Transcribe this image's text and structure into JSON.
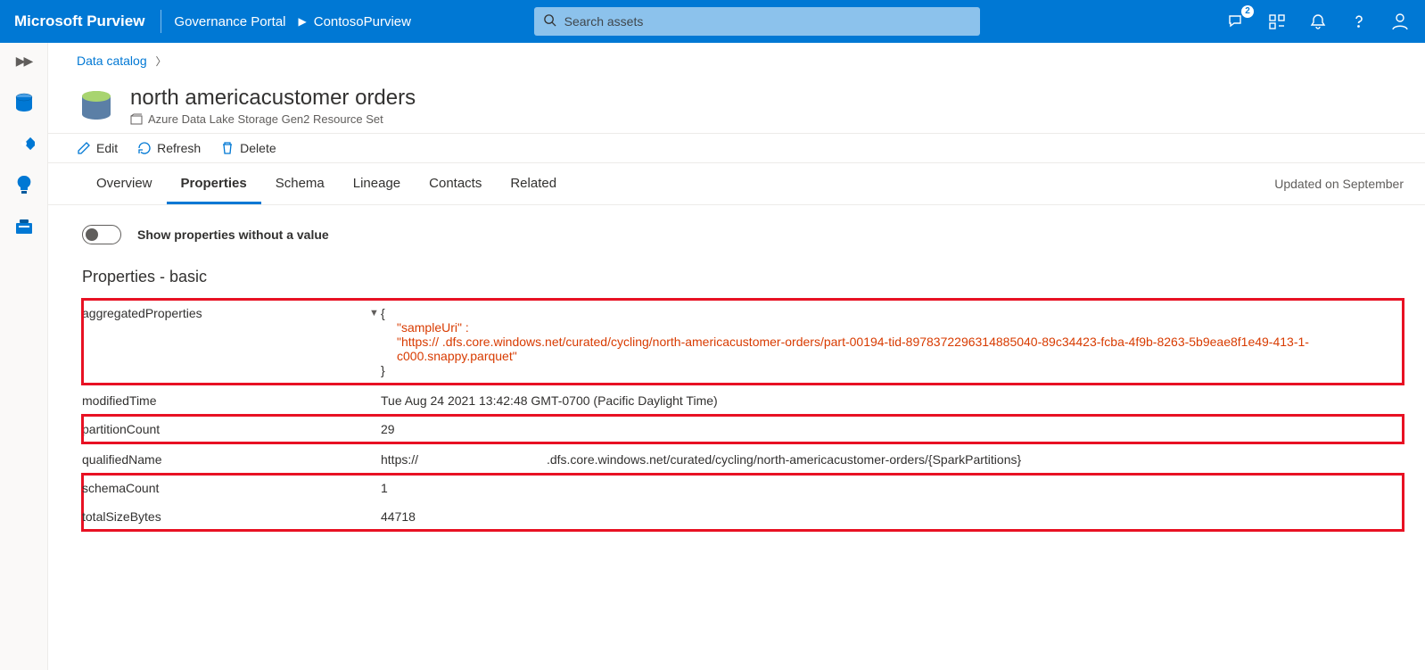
{
  "header": {
    "brand": "Microsoft Purview",
    "portal": "Governance Portal",
    "account": "ContosoPurview",
    "search_placeholder": "Search assets",
    "badge_feedback": "2"
  },
  "breadcrumb": {
    "link": "Data catalog"
  },
  "asset": {
    "title": "north americacustomer orders",
    "subtitle": "Azure Data Lake Storage Gen2 Resource Set"
  },
  "actions": {
    "edit": "Edit",
    "refresh": "Refresh",
    "delete": "Delete"
  },
  "tabs": {
    "overview": "Overview",
    "properties": "Properties",
    "schema": "Schema",
    "lineage": "Lineage",
    "contacts": "Contacts",
    "related": "Related"
  },
  "updated_text": "Updated on September",
  "toggle_label": "Show properties without a value",
  "section_title": "Properties - basic",
  "props": {
    "aggregatedProperties": {
      "key": "aggregatedProperties",
      "open_brace": "{",
      "sample_key": "\"sampleUri\" :",
      "sample_url": "\"https://                              .dfs.core.windows.net/curated/cycling/north-americacustomer-orders/part-00194-tid-8978372296314885040-89c34423-fcba-4f9b-8263-5b9eae8f1e49-413-1-c000.snappy.parquet\"",
      "close_brace": "}"
    },
    "modifiedTime": {
      "key": "modifiedTime",
      "val": "Tue Aug 24 2021 13:42:48 GMT-0700 (Pacific Daylight Time)"
    },
    "partitionCount": {
      "key": "partitionCount",
      "val": "29"
    },
    "qualifiedName": {
      "key": "qualifiedName",
      "val": "https://                                     .dfs.core.windows.net/curated/cycling/north-americacustomer-orders/{SparkPartitions}"
    },
    "schemaCount": {
      "key": "schemaCount",
      "val": "1"
    },
    "totalSizeBytes": {
      "key": "totalSizeBytes",
      "val": "44718"
    }
  }
}
